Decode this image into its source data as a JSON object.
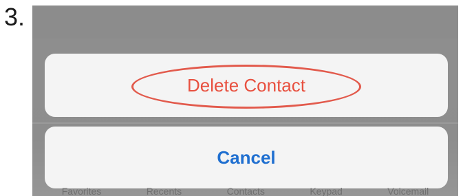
{
  "step": {
    "number_label": "3."
  },
  "action_sheet": {
    "delete_label": "Delete Contact",
    "cancel_label": "Cancel"
  },
  "tab_bar": {
    "items": [
      "Favorites",
      "Recents",
      "Contacts",
      "Keypad",
      "Voicemail"
    ]
  },
  "colors": {
    "destructive": "#e8503f",
    "highlight_ring": "#e25a4c",
    "cancel": "#1f6fd0",
    "sheet_bg": "#f4f4f4",
    "dim_overlay": "#8f8f8f"
  }
}
